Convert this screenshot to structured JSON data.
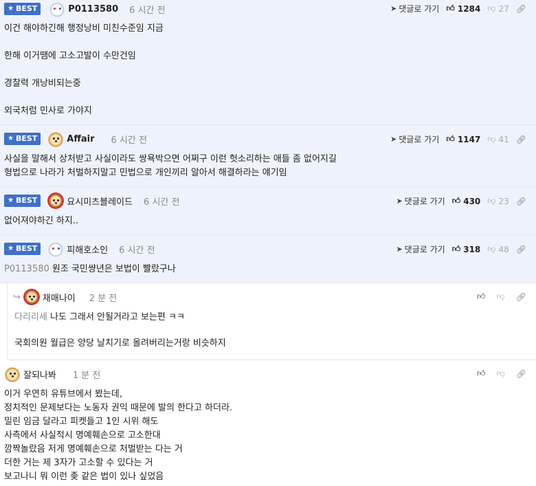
{
  "labels": {
    "best": "BEST",
    "reply_link": "댓글로 가기"
  },
  "comments": [
    {
      "nick": "P0113580",
      "time": "6 시간 전",
      "likes": "1284",
      "dislikes": "27",
      "lines": [
        "이건 해야하긴해 행정낭비 미친수준임 지금",
        "한해 이거땜에 고소고발이 수만건임",
        "경찰력 개낭비되는중",
        "외국처럼 민사로 가야지"
      ]
    },
    {
      "nick": "Affair",
      "time": "6 시간 전",
      "likes": "1147",
      "dislikes": "41",
      "lines": [
        "사실을 말해서 상처받고 사실이라도 쌍욕박으면 어쩌구 이런 헛소리하는 애들 좀 없어지길",
        "형법으로 나라가 처벌하지말고 민법으로 개인끼리 알아서 해결하라는 얘기임"
      ]
    },
    {
      "nick": "요시미츠블레이드",
      "time": "6 시간 전",
      "likes": "430",
      "dislikes": "23",
      "lines": [
        "없어져야하긴 하지.."
      ]
    },
    {
      "nick": "피해호소인",
      "time": "6 시간 전",
      "likes": "318",
      "dislikes": "48",
      "mention": "P0113580",
      "lines": [
        "원조 국민썅년은 보법이 빨랐구나"
      ]
    },
    {
      "nick": "재매나이",
      "time": "2 분 전",
      "mention": "다리리세",
      "lines": [
        "나도 그래서 안될거라고 보는편 ㅋㅋ",
        "국회의원 월급은 양당 날치기로 올려버리는거랑 비슷하지"
      ]
    },
    {
      "nick": "잘되나봐",
      "time": "1 분 전",
      "lines": [
        "이거 우연히 유튜브에서 봤는데,",
        "정치적인 문제보다는 노동자 권익 때문에 발의 한다고 하더라.",
        "밀린 임금 달라고 피켓들고 1인 시위 해도",
        "사측에서 사실적시 명예훼손으로 고소한대",
        "깜짝놀랐음 저게 명예훼손으로 처벌받는 다는 거",
        "더한 거는 제 3자가 고소할 수 있다는 거",
        "보고나니 뭐 이런 좆 같은 법이 있나 싶었음"
      ]
    }
  ]
}
